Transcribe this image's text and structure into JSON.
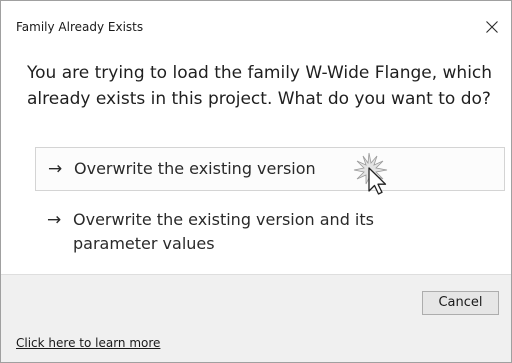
{
  "dialog": {
    "title": "Family Already Exists",
    "close_icon": "close-x-icon",
    "main_instruction": "You are trying to load the family W-Wide Flange, which already exists in this project.  What do you want to do?"
  },
  "options": [
    {
      "arrow": "→",
      "label": "Overwrite the existing version",
      "state": "hover"
    },
    {
      "arrow": "→",
      "label": "Overwrite the existing version and its parameter values",
      "state": "normal"
    }
  ],
  "footer": {
    "cancel_label": "Cancel"
  },
  "help": {
    "link_text": "Click here to learn more"
  },
  "pointer": {
    "icon": "mouse-pointer-icon",
    "effect": "click-burst"
  },
  "colors": {
    "dialog_background": "#ffffff",
    "footer_background": "#f0f0f0",
    "hover_border": "#d4d4d4",
    "button_background": "#e6e6e6",
    "button_border": "#adadad"
  }
}
